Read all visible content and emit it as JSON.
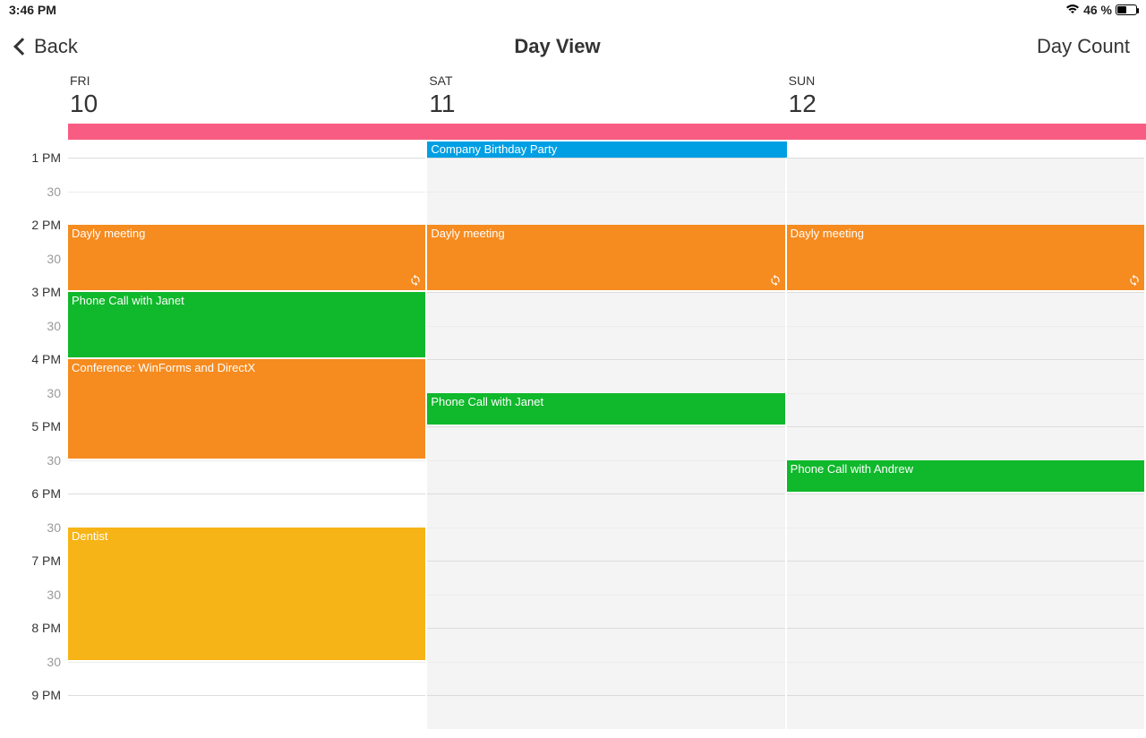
{
  "statusbar": {
    "time": "3:46 PM",
    "battery_pct": "46 %"
  },
  "nav": {
    "back": "Back",
    "title": "Day View",
    "right": "Day Count"
  },
  "days": [
    {
      "dow": "FRI",
      "num": "10"
    },
    {
      "dow": "SAT",
      "num": "11"
    },
    {
      "dow": "SUN",
      "num": "12"
    }
  ],
  "timeLabels": [
    "1 PM",
    "30",
    "2 PM",
    "30",
    "3 PM",
    "30",
    "4 PM",
    "30",
    "5 PM",
    "30",
    "6 PM",
    "30",
    "7 PM",
    "30",
    "8 PM",
    "30",
    "9 PM"
  ],
  "slotHeight": 37.5,
  "gridStartSlot": 0,
  "alldayBar": {
    "startCol": 0,
    "spanCols": 3
  },
  "allday2": {
    "col": 1,
    "title": "Company Birthday Party",
    "color": "blue"
  },
  "events": [
    {
      "col": 0,
      "title": "Dayly meeting",
      "color": "orange",
      "startSlot": 2,
      "durSlots": 2,
      "recurring": true
    },
    {
      "col": 1,
      "title": "Dayly meeting",
      "color": "orange",
      "startSlot": 2,
      "durSlots": 2,
      "recurring": true
    },
    {
      "col": 2,
      "title": "Dayly meeting",
      "color": "orange",
      "startSlot": 2,
      "durSlots": 2,
      "recurring": true
    },
    {
      "col": 0,
      "title": "Phone Call with Janet",
      "color": "green",
      "startSlot": 4,
      "durSlots": 2,
      "recurring": false
    },
    {
      "col": 0,
      "title": "Conference: WinForms and DirectX",
      "color": "orange",
      "startSlot": 6,
      "durSlots": 3,
      "recurring": false
    },
    {
      "col": 1,
      "title": "Phone Call with Janet",
      "color": "green",
      "startSlot": 7,
      "durSlots": 1,
      "recurring": false
    },
    {
      "col": 2,
      "title": "Phone Call with Andrew",
      "color": "green",
      "startSlot": 9,
      "durSlots": 1,
      "recurring": false
    },
    {
      "col": 0,
      "title": "Dentist",
      "color": "yellow",
      "startSlot": 11,
      "durSlots": 4,
      "recurring": false
    }
  ],
  "shadedCols": [
    1,
    2
  ],
  "colors": {
    "orange": "#f68b1f",
    "green": "#10b82b",
    "yellow": "#f7b417",
    "blue": "#009fe3",
    "pink": "#f85c82"
  }
}
